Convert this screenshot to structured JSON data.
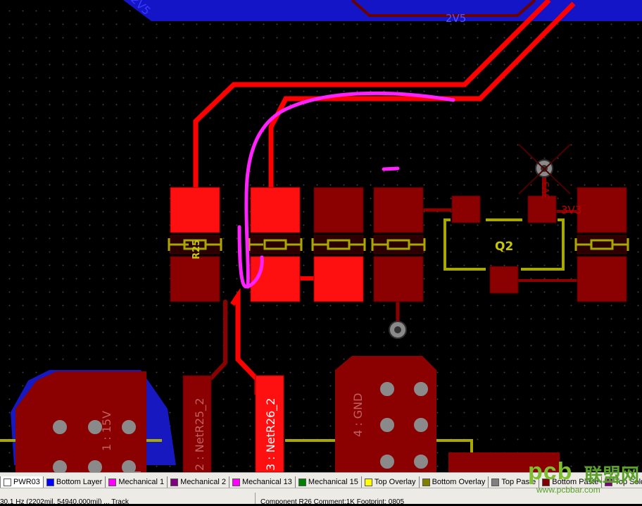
{
  "pcb": {
    "net_labels": {
      "v2v5_top": "2V5",
      "v2v5_right": "2V5",
      "v3v3_a": "3V3",
      "v3v3_b": "3V3",
      "pad_15v": "1 : 15V",
      "pad_netr25": "2 : NetR25_2",
      "pad_netr26": "3 : NetR26_2",
      "pad_gnd": "4 : GND"
    },
    "designators": {
      "q2": "Q2",
      "r25": "R25"
    }
  },
  "layer_tabs": [
    {
      "label": "PWR03",
      "color": "#ffffff",
      "active": true
    },
    {
      "label": "Bottom Layer",
      "color": "#0000ff"
    },
    {
      "label": "Mechanical 1",
      "color": "#ff00ff"
    },
    {
      "label": "Mechanical 2",
      "color": "#800080"
    },
    {
      "label": "Mechanical 13",
      "color": "#ff00ff"
    },
    {
      "label": "Mechanical 15",
      "color": "#008000"
    },
    {
      "label": "Top Overlay",
      "color": "#ffff00"
    },
    {
      "label": "Bottom Overlay",
      "color": "#808000"
    },
    {
      "label": "Top Paste",
      "color": "#808080"
    },
    {
      "label": "Bottom Paste",
      "color": "#800000"
    },
    {
      "label": "Top Solder",
      "color": "#800080"
    }
  ],
  "status": {
    "left": "30.1 Hz (2202mil, 54940.000mil) ... Track",
    "middle": "Component R26 Comment:1K Footprint: 0805"
  },
  "watermark": {
    "logo": "pcb",
    "chinese": "联盟网",
    "url": "www.pcbbar.com"
  }
}
